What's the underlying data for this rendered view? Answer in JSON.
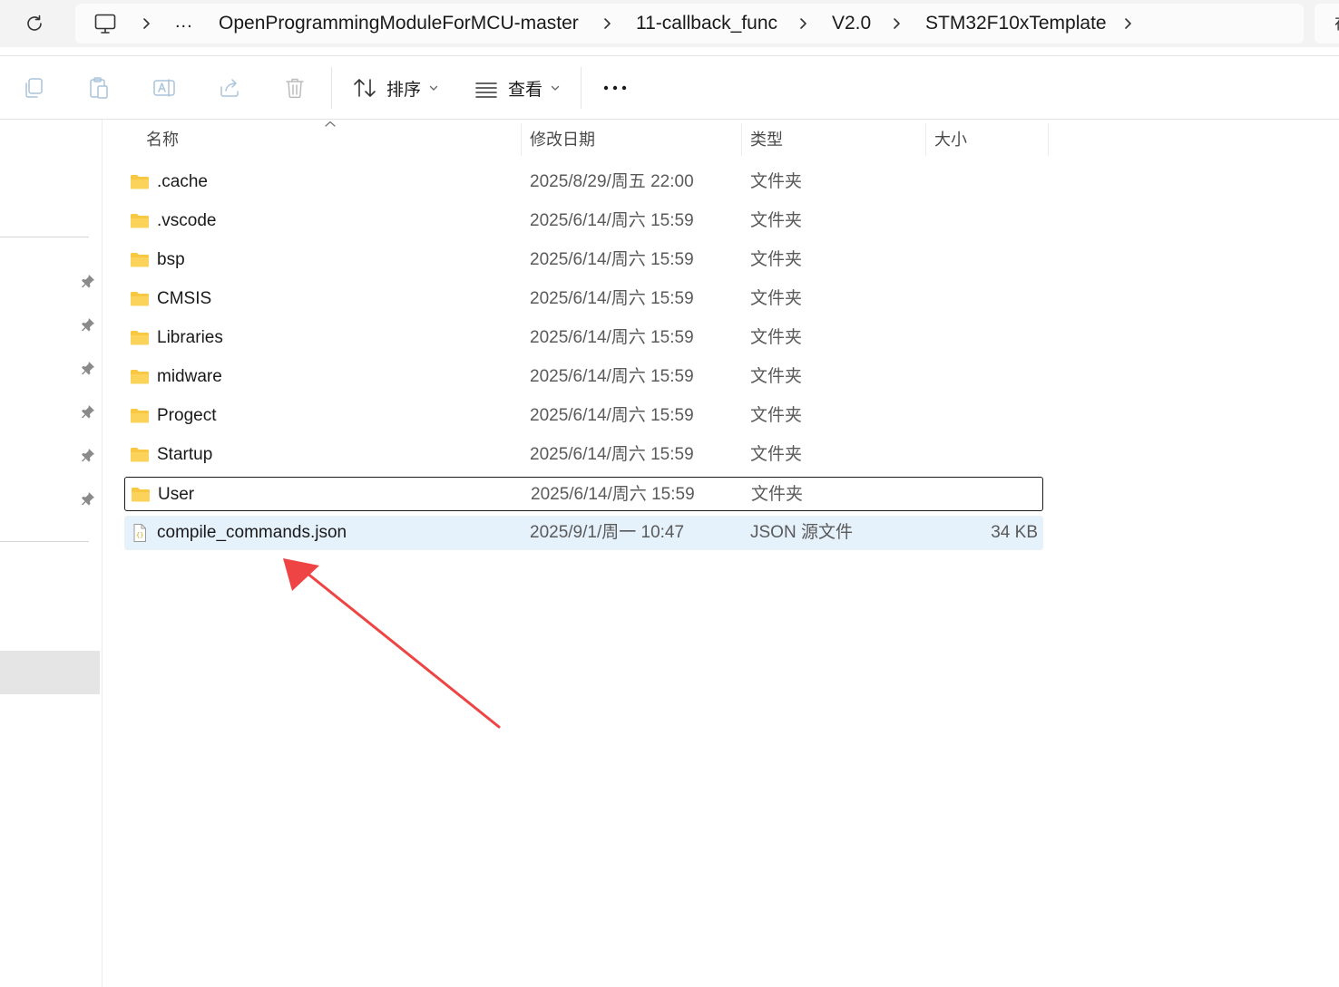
{
  "breadcrumb": {
    "overflow": "...",
    "items": [
      "OpenProgrammingModuleForMCU-master",
      "11-callback_func",
      "V2.0",
      "STM32F10xTemplate"
    ],
    "search_edge_text": "在"
  },
  "toolbar": {
    "sort_label": "排序",
    "view_label": "查看",
    "more_label": "..."
  },
  "columns": {
    "name": "名称",
    "date": "修改日期",
    "type": "类型",
    "size": "大小"
  },
  "files": [
    {
      "name": ".cache",
      "date": "2025/8/29/周五 22:00",
      "type": "文件夹",
      "size": "",
      "icon": "folder-icon"
    },
    {
      "name": ".vscode",
      "date": "2025/6/14/周六 15:59",
      "type": "文件夹",
      "size": "",
      "icon": "folder-icon"
    },
    {
      "name": "bsp",
      "date": "2025/6/14/周六 15:59",
      "type": "文件夹",
      "size": "",
      "icon": "folder-icon"
    },
    {
      "name": "CMSIS",
      "date": "2025/6/14/周六 15:59",
      "type": "文件夹",
      "size": "",
      "icon": "folder-icon"
    },
    {
      "name": "Libraries",
      "date": "2025/6/14/周六 15:59",
      "type": "文件夹",
      "size": "",
      "icon": "folder-icon"
    },
    {
      "name": "midware",
      "date": "2025/6/14/周六 15:59",
      "type": "文件夹",
      "size": "",
      "icon": "folder-icon"
    },
    {
      "name": "Progect",
      "date": "2025/6/14/周六 15:59",
      "type": "文件夹",
      "size": "",
      "icon": "folder-icon"
    },
    {
      "name": "Startup",
      "date": "2025/6/14/周六 15:59",
      "type": "文件夹",
      "size": "",
      "icon": "folder-icon"
    },
    {
      "name": "User",
      "date": "2025/6/14/周六 15:59",
      "type": "文件夹",
      "size": "",
      "icon": "folder-icon"
    },
    {
      "name": "compile_commands.json",
      "date": "2025/9/1/周一 10:47",
      "type": "JSON 源文件",
      "size": "34 KB",
      "icon": "json-file-icon"
    }
  ],
  "colors": {
    "folder": "#f8c843",
    "selection": "#e5f1fb",
    "annotation_arrow": "#ee4444"
  }
}
